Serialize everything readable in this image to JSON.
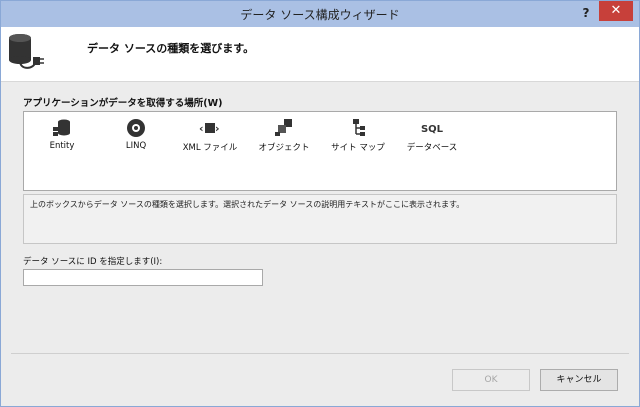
{
  "window": {
    "title": "データ ソース構成ウィザード",
    "help_label": "?",
    "close_label": "✕"
  },
  "header": {
    "text": "データ ソースの種類を選びます。"
  },
  "source_section": {
    "label": "アプリケーションがデータを取得する場所(W)",
    "items": [
      {
        "label": "Entity",
        "icon": "entity-icon"
      },
      {
        "label": "LINQ",
        "icon": "linq-icon"
      },
      {
        "label": "XML ファイル",
        "icon": "xml-file-icon"
      },
      {
        "label": "オブジェクト",
        "icon": "object-icon"
      },
      {
        "label": "サイト マップ",
        "icon": "site-map-icon"
      },
      {
        "label": "データベース",
        "icon": "database-icon",
        "icon_text": "SQL"
      }
    ]
  },
  "description": {
    "text": "上のボックスからデータ ソースの種類を選択します。選択されたデータ ソースの説明用テキストがここに表示されます。"
  },
  "id_field": {
    "label": "データ ソースに ID を指定します(I):",
    "value": ""
  },
  "buttons": {
    "ok_label": "OK",
    "ok_enabled": false,
    "cancel_label": "キャンセル"
  }
}
